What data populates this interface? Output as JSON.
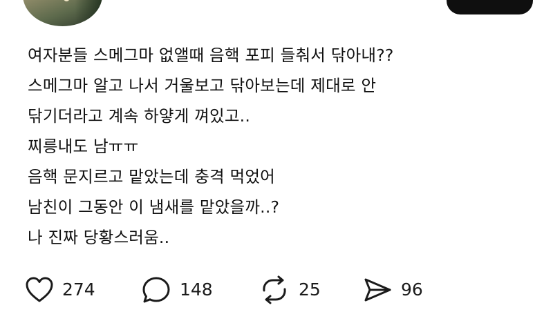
{
  "post": {
    "lines": [
      "여자분들 스메그마 없앨때 음핵 포피 들춰서 닦아내??",
      "스메그마 알고 나서 거울보고 닦아보는데 제대로 안",
      "닦기더라고 계속 하얗게 껴있고..",
      "찌릉내도 남ㅠㅠ",
      "음핵 문지르고 맡았는데 충격 먹었어",
      "남친이 그동안 이 냄새를 맡았을까..?",
      "나 진짜 당황스러움.."
    ]
  },
  "actions": {
    "like": {
      "icon": "heart-icon",
      "count": "274"
    },
    "comment": {
      "icon": "comment-bubble-icon",
      "count": "148"
    },
    "repost": {
      "icon": "repost-icon",
      "count": "25"
    },
    "share": {
      "icon": "send-icon",
      "count": "96"
    }
  }
}
